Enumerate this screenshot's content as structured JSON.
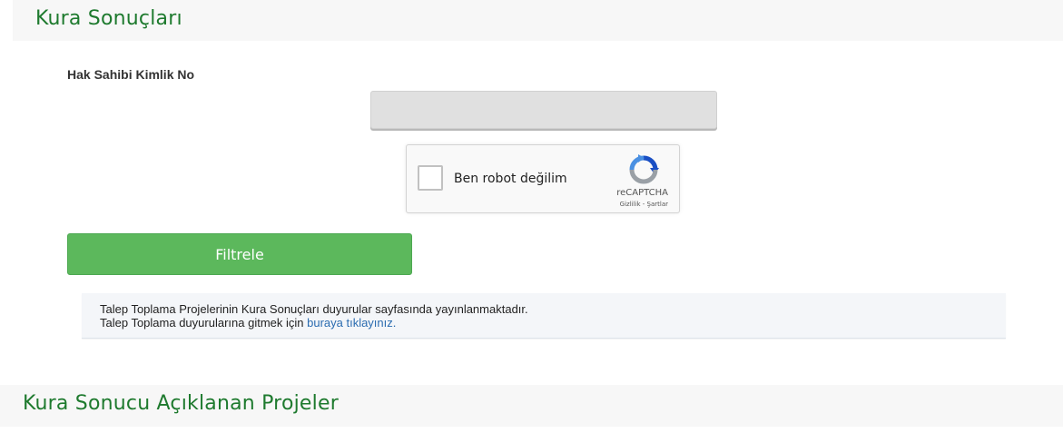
{
  "header": {
    "title": "Kura Sonuçları"
  },
  "form": {
    "id_label": "Hak Sahibi Kimlik No",
    "id_value": "",
    "recaptcha": {
      "label": "Ben robot değilim",
      "brand": "reCAPTCHA",
      "privacy": "Gizlilik",
      "separator": " - ",
      "terms": "Şartlar"
    },
    "filter_label": "Filtrele"
  },
  "notice": {
    "line1": "Talep Toplama Projelerinin Kura Sonuçları duyurular sayfasında yayınlanmaktadır.",
    "line2_prefix": "Talep Toplama duyurularına gitmek için ",
    "link_text": "buraya tıklayınız."
  },
  "section2": {
    "title": "Kura Sonucu Açıklanan Projeler"
  },
  "colors": {
    "brand_green": "#1e7a2e",
    "button_green": "#5cb85c",
    "link_blue": "#2b6cb0"
  }
}
